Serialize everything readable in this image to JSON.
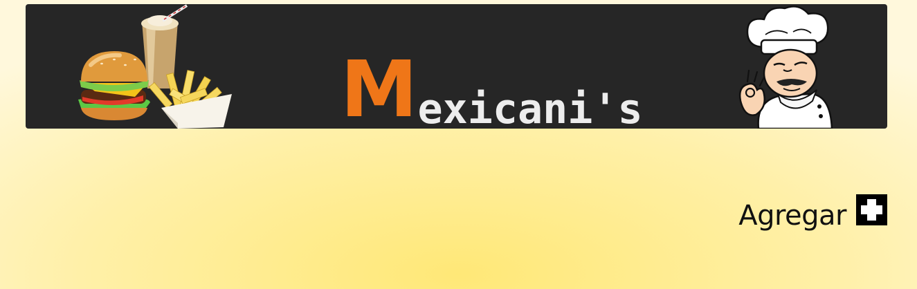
{
  "header": {
    "brand_first_letter": "M",
    "brand_rest": "exicani's",
    "food_illustration_icon": "burger-shake-fries-illustration",
    "chef_illustration_icon": "chef-ok-hand-illustration",
    "colors": {
      "background": "#262626",
      "brand_accent": "#ef7618",
      "brand_text": "#ededed"
    }
  },
  "actions": {
    "add_label": "Agregar",
    "add_icon": "plus-box-icon"
  },
  "colors": {
    "page_bg_center": "#ffe877",
    "page_bg_edge": "#fff8dc"
  }
}
